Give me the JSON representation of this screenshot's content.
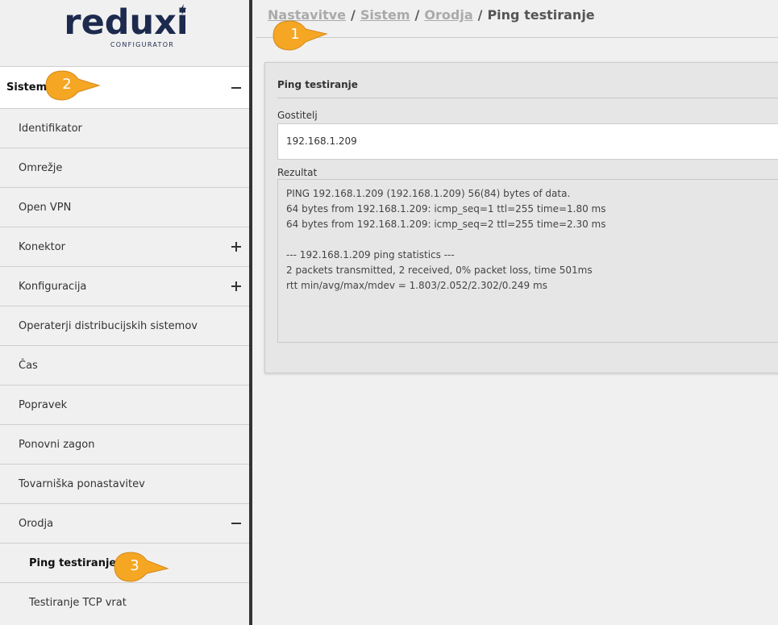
{
  "logo": {
    "word": "reduxi",
    "subtitle": "CONFIGURATOR"
  },
  "sidebar": {
    "items": [
      {
        "label": "Sistem",
        "toggle": "minus"
      },
      {
        "label": "Identifikator"
      },
      {
        "label": "Omrežje"
      },
      {
        "label": "Open VPN"
      },
      {
        "label": "Konektor",
        "toggle": "plus"
      },
      {
        "label": "Konfiguracija",
        "toggle": "plus"
      },
      {
        "label": "Operaterji distribucijskih sistemov"
      },
      {
        "label": "Čas"
      },
      {
        "label": "Popravek"
      },
      {
        "label": "Ponovni zagon"
      },
      {
        "label": "Tovarniška ponastavitev"
      },
      {
        "label": "Orodja",
        "toggle": "minus"
      },
      {
        "label": "Ping testiranje"
      },
      {
        "label": "Testiranje TCP vrat"
      }
    ]
  },
  "breadcrumb": {
    "items": [
      "Nastavitve",
      "Sistem",
      "Orodja"
    ],
    "current": "Ping testiranje",
    "separator": "/"
  },
  "panel": {
    "title": "Ping testiranje",
    "host_label": "Gostitelj",
    "host_value": "192.168.1.209",
    "result_label": "Rezultat",
    "result_text": "PING 192.168.1.209 (192.168.1.209) 56(84) bytes of data.\n64 bytes from 192.168.1.209: icmp_seq=1 ttl=255 time=1.80 ms\n64 bytes from 192.168.1.209: icmp_seq=2 ttl=255 time=2.30 ms\n\n--- 192.168.1.209 ping statistics ---\n2 packets transmitted, 2 received, 0% packet loss, time 501ms\nrtt min/avg/max/mdev = 1.803/2.052/2.302/0.249 ms"
  },
  "callouts": [
    "1",
    "2",
    "3"
  ],
  "colors": {
    "logo": "#1d2a4e",
    "callout": "#f5a623",
    "sidebar_border": "#333333"
  }
}
